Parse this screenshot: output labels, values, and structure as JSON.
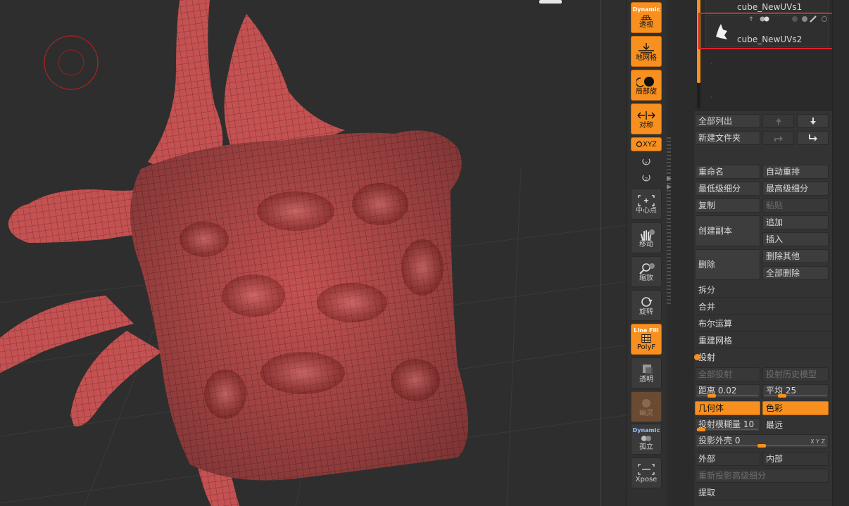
{
  "toolbar": {
    "perspective": {
      "top": "Dynamic",
      "label": "透视"
    },
    "floor": {
      "label": "地网格"
    },
    "local": {
      "label": "局部旋"
    },
    "symmetry": {
      "label": "对称"
    },
    "xyz": {
      "label": "XYZ"
    },
    "center": {
      "label": "中心点"
    },
    "move": {
      "label": "移动"
    },
    "zoom": {
      "label": "缩放"
    },
    "rotate": {
      "label": "旋转"
    },
    "polyf": {
      "top": "Line Fill",
      "label": "PolyF"
    },
    "transp": {
      "label": "透明"
    },
    "ghost": {
      "label": "幽灵"
    },
    "solo": {
      "top": "Dynamic",
      "label": "孤立"
    },
    "xpose": {
      "label": "Xpose"
    }
  },
  "subtools": [
    {
      "name": "cube_NewUVs1"
    },
    {
      "name": "cube_NewUVs2",
      "selected": true
    }
  ],
  "panel": {
    "list_all": "全部列出",
    "new_folder": "新建文件夹",
    "rename": "重命名",
    "auto_reorder": "自动重排",
    "lowest_res": "最低级细分",
    "highest_res": "最高级细分",
    "duplicate": "复制",
    "paste": "粘贴",
    "create_copy": "创建副本",
    "append": "追加",
    "insert": "插入",
    "delete": "删除",
    "delete_other": "删除其他",
    "delete_all": "全部删除",
    "split": "拆分",
    "merge": "合并",
    "boolean": "布尔运算",
    "remesh": "重建网格",
    "project_section": "投射",
    "project_all": "全部投射",
    "project_history": "投射历史模型",
    "distance": {
      "label": "距离",
      "value": "0.02",
      "fraction": 0.2
    },
    "mean": {
      "label": "平均",
      "value": "25",
      "fraction": 0.25
    },
    "geometry": "几何体",
    "color": "色彩",
    "proj_blur": {
      "label": "投射模糊量",
      "value": "10"
    },
    "farthest": "最远",
    "proj_shell": {
      "label": "投影外壳",
      "value": "0",
      "fraction": 0.5,
      "xyz": "X Y Z"
    },
    "outer": "外部",
    "inner": "内部",
    "reproject_higher": "重新投影高级细分",
    "extract": "提取"
  },
  "colors": {
    "accent": "#f7901e",
    "mesh": "#c24f4f",
    "highlight": "#e0202a"
  }
}
